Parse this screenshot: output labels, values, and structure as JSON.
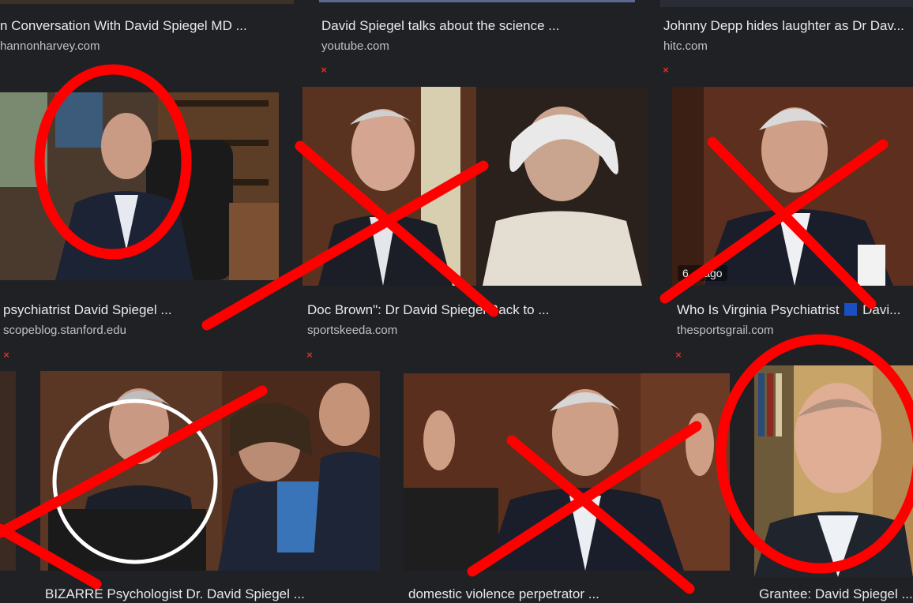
{
  "results": [
    {
      "title": "n Conversation With David Spiegel MD ...",
      "source": "hannonharvey.com"
    },
    {
      "title": "David Spiegel talks about the science ...",
      "source": "youtube.com"
    },
    {
      "title": "Johnny Depp hides laughter as Dr Dav...",
      "source": "hitc.com"
    },
    {
      "title": "psychiatrist David Spiegel ...",
      "source": "scopeblog.stanford.edu"
    },
    {
      "title": "Doc Brown\": Dr David Spiegel Back to ...",
      "source": "sportskeeda.com"
    },
    {
      "title_a": "Who Is Virginia Psychiatrist",
      "title_b": "Davi...",
      "source": "thesportsgrail.com",
      "time_badge": "6 ... ago"
    },
    {
      "title": "BIZARRE Psychologist Dr. David Spiegel ..."
    },
    {
      "title": "domestic violence perpetrator ..."
    },
    {
      "title": "Grantee: David Spiegel ..."
    }
  ],
  "icons": {
    "broken_image": "×"
  },
  "annotation_color": "#ff0000"
}
